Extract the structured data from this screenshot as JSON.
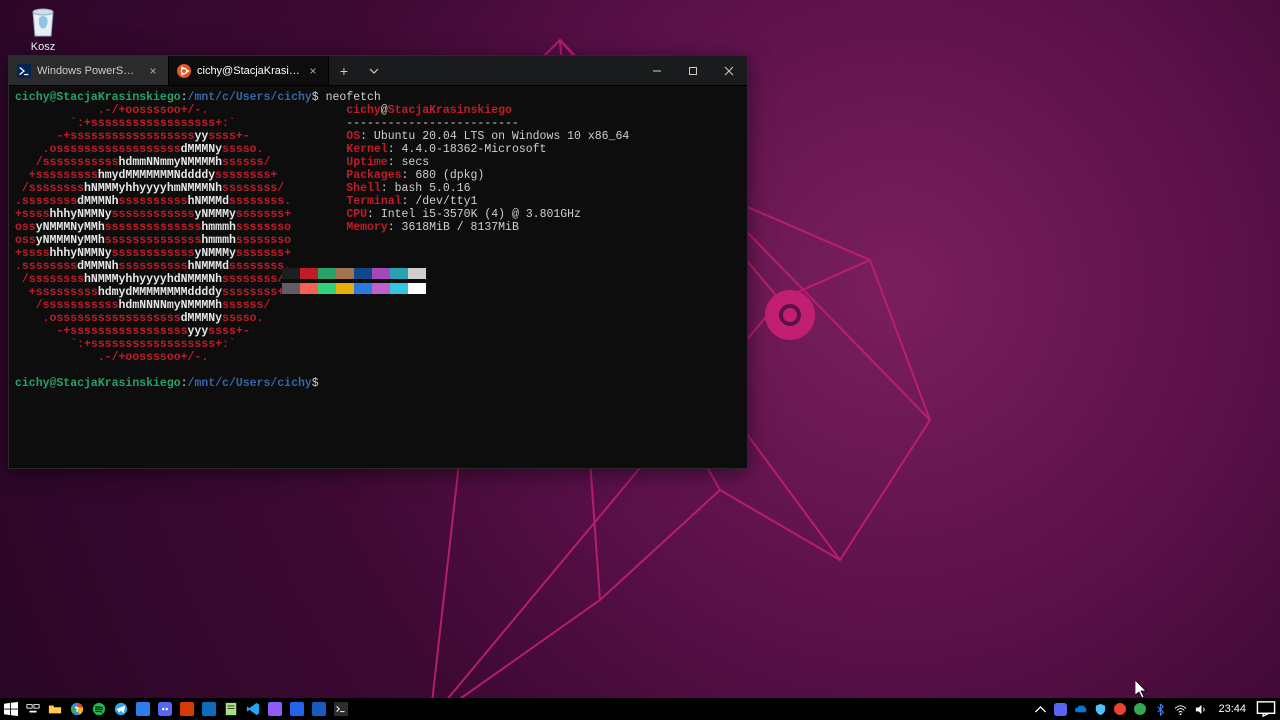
{
  "desktop": {
    "recycle_bin_label": "Kosz"
  },
  "window": {
    "tabs": [
      {
        "label": "Windows PowerShell",
        "active": false
      },
      {
        "label": "cichy@StacjaKrasinskiego: /mnt",
        "active": true
      }
    ],
    "controls": {
      "minimize": "—",
      "maximize": "▢",
      "close": "✕"
    }
  },
  "terminal": {
    "prompt_user": "cichy@StacjaKrasinskiego",
    "prompt_sep": ":",
    "prompt_path": "/mnt/c/Users/cichy",
    "prompt_sym": "$ ",
    "command": "neofetch",
    "ascii": [
      "            .-/+oossssoo+/-.",
      "        `:+ssssssssssssssssss+:`",
      "      -+ssssssssssssssssssyyssss+-",
      "    .ossssssssssssssssssdMMMNysssso.",
      "   /ssssssssssshdmmNNmmyNMMMMhssssss/",
      "  +ssssssssshmydMMMMMMMNddddyssssssss+",
      " /sssssssshNMMMyhhyyyyhmNMMMNhssssssss/",
      ".ssssssssdMMMNhsssssssssshNMMMdssssssss.",
      "+sssshhhyNMMNyssssssssssssyNMMMysssssss+",
      "ossyNMMMNyMMhsssssssssssssshmmmhssssssso",
      "ossyNMMMNyMMhsssssssssssssshmmmhssssssso",
      "+sssshhhyNMMNyssssssssssssyNMMMysssssss+",
      ".ssssssssdMMMNhsssssssssshNMMMdssssssss.",
      " /sssssssshNMMMyhhyyyyhdNMMMNhssssssss/",
      "  +ssssssssshdmydMMMMMMMMddddyssssssss+",
      "   /ssssssssssshdmNNNNmyNMMMMhssssss/",
      "    .ossssssssssssssssssdMMMNysssso.",
      "      -+sssssssssssssssssyyyssss+-",
      "        `:+ssssssssssssssssss+:`",
      "            .-/+oossssoo+/-."
    ],
    "info_title_user": "cichy",
    "info_title_sep": "@",
    "info_title_host": "StacjaKrasinskiego",
    "info_divider": "-------------------------",
    "info": [
      {
        "key": "OS",
        "value": "Ubuntu 20.04 LTS on Windows 10 x86_64"
      },
      {
        "key": "Kernel",
        "value": "4.4.0-18362-Microsoft"
      },
      {
        "key": "Uptime",
        "value": "secs"
      },
      {
        "key": "Packages",
        "value": "680 (dpkg)"
      },
      {
        "key": "Shell",
        "value": "bash 5.0.16"
      },
      {
        "key": "Terminal",
        "value": "/dev/tty1"
      },
      {
        "key": "CPU",
        "value": "Intel i5-3570K (4) @ 3.801GHz"
      },
      {
        "key": "Memory",
        "value": "3618MiB / 8137MiB"
      }
    ],
    "palette_dark": [
      "#1e1e1e",
      "#c01c28",
      "#26a269",
      "#a2734c",
      "#12488b",
      "#a347ba",
      "#2aa1b3",
      "#d0cfcc"
    ],
    "palette_light": [
      "#5e5c64",
      "#f66151",
      "#33d17a",
      "#e9ad0c",
      "#2a7bde",
      "#c061cb",
      "#33c7de",
      "#ffffff"
    ]
  },
  "taskbar": {
    "clock": "23:44"
  }
}
